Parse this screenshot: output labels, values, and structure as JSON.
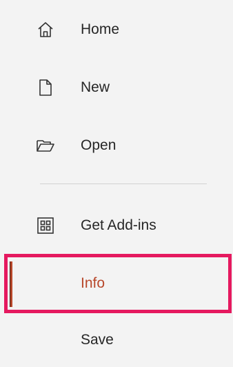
{
  "menu": {
    "items": [
      {
        "label": "Home",
        "icon": "home-icon"
      },
      {
        "label": "New",
        "icon": "new-document-icon"
      },
      {
        "label": "Open",
        "icon": "open-folder-icon"
      },
      {
        "label": "Get Add-ins",
        "icon": "add-ins-grid-icon"
      },
      {
        "label": "Info",
        "selected": true
      },
      {
        "label": "Save"
      }
    ],
    "colors": {
      "background": "#f3f3f3",
      "text": "#262626",
      "accent": "#b7472a",
      "highlight_border": "#e5195f",
      "divider": "#d2d2d2"
    }
  }
}
